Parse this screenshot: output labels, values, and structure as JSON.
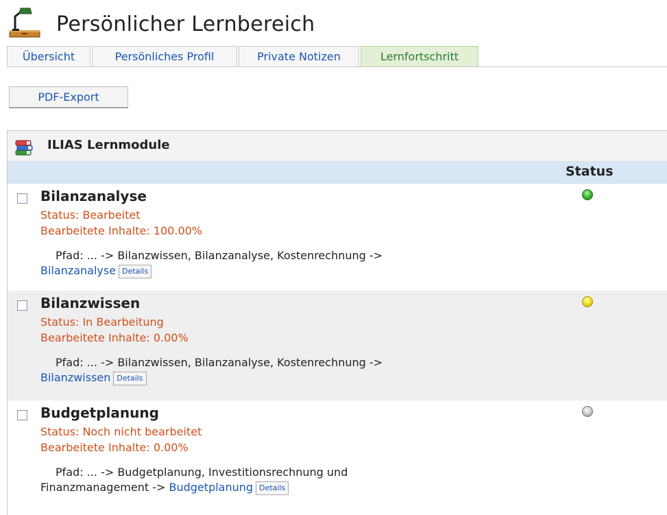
{
  "header": {
    "title": "Persönlicher Lernbereich",
    "icon": "desk-lamp-icon"
  },
  "tabs": [
    {
      "label": "Übersicht",
      "active": false
    },
    {
      "label": "Persönliches Profil",
      "active": false
    },
    {
      "label": "Private Notizen",
      "active": false
    },
    {
      "label": "Lernfortschritt",
      "active": true
    }
  ],
  "toolbar": {
    "pdf_export_label": "PDF-Export"
  },
  "table": {
    "title": "ILIAS Lernmodule",
    "icon": "books-icon",
    "status_column_label": "Status",
    "rows": [
      {
        "title": "Bilanzanalyse",
        "status": "Status: Bearbeitet",
        "progress": "Bearbeitete Inhalte: 100.00%",
        "path_prefix": "Pfad: ... -> Bilanzwissen, Bilanzanalyse, Kostenrechnung ->",
        "path_tail_text": "",
        "path_link": "Bilanzanalyse",
        "details_label": "Details",
        "status_light": "green"
      },
      {
        "title": "Bilanzwissen",
        "status": "Status: In Bearbeitung",
        "progress": "Bearbeitete Inhalte: 0.00%",
        "path_prefix": "Pfad: ... -> Bilanzwissen, Bilanzanalyse, Kostenrechnung ->",
        "path_tail_text": "",
        "path_link": "Bilanzwissen",
        "details_label": "Details",
        "status_light": "yellow"
      },
      {
        "title": "Budgetplanung",
        "status": "Status: Noch nicht bearbeitet",
        "progress": "Bearbeitete Inhalte: 0.00%",
        "path_prefix": "Pfad: ... -> Budgetplanung, Investitionsrechnung und",
        "path_tail_text": "Finanzmanagement ->",
        "path_link": "Budgetplanung",
        "details_label": "Details",
        "status_light": "grey"
      }
    ]
  },
  "colors": {
    "link": "#1a55b5",
    "status_text": "#d0501a",
    "active_tab_bg": "#e3f0d6",
    "column_header_bg": "#d8e5f5"
  }
}
